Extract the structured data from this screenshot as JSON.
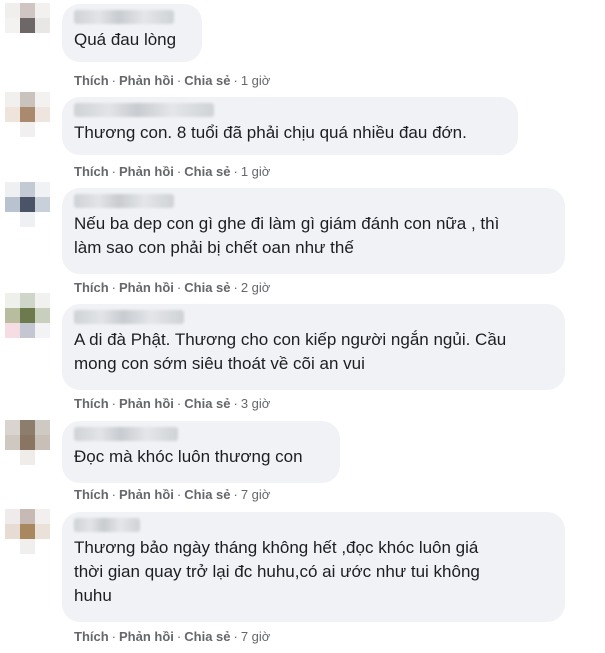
{
  "comments": [
    {
      "text": "Quá đau lòng",
      "time": "1 giờ"
    },
    {
      "text": "Thương con. 8 tuổi đã phải chịu quá nhiều đau đớn.",
      "time": "1 giờ"
    },
    {
      "text": "Nếu ba dep con gì ghe đi làm gì giám đánh con nữa , thì\nlàm sao con phải bị chết oan như thế",
      "time": "2 giờ"
    },
    {
      "text": "A di đà Phật. Thương cho con kiếp người ngắn ngủi. Cầu\nmong con sớm siêu thoát về cõi an vui",
      "time": "3 giờ"
    },
    {
      "text": "Đọc mà khóc luôn thương con",
      "time": "7 giờ"
    },
    {
      "text": "Thương bảo ngày tháng không hết ,đọc khóc luôn giá\nthời gian quay trở lại đc huhu,có ai ước như tui không\nhuhu",
      "time": "7 giờ"
    }
  ],
  "actions": {
    "like": "Thích",
    "reply": "Phản hồi",
    "share": "Chia sẻ",
    "separator": "·"
  },
  "colors": {
    "bubble": "#f0f2f5",
    "meta": "#65676b",
    "text": "#1c1e21"
  }
}
